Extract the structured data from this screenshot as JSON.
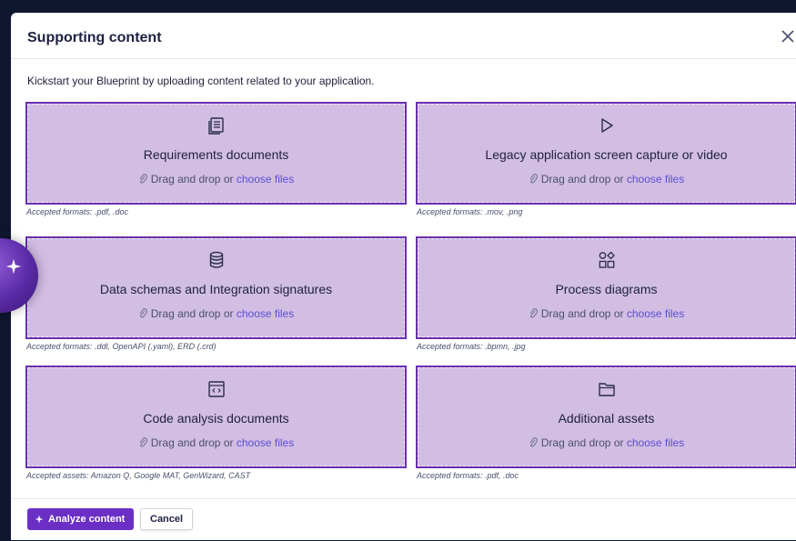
{
  "modal": {
    "title": "Supporting content",
    "intro": "Kickstart your Blueprint by uploading content related to your application."
  },
  "dropzone": {
    "drag_text": "Drag and drop or",
    "choose_text": "choose files"
  },
  "cards": [
    {
      "title": "Requirements documents",
      "icon": "document-list-icon",
      "formats": "Accepted formats: .pdf, .doc"
    },
    {
      "title": "Legacy application screen capture or video",
      "icon": "play-icon",
      "formats": "Accepted formats: .mov, .png"
    },
    {
      "title": "Data schemas and Integration signatures",
      "icon": "database-icon",
      "formats": "Accepted formats: .ddl, OpenAPI (.yaml), ERD (.crd)"
    },
    {
      "title": "Process diagrams",
      "icon": "shapes-icon",
      "formats": "Accepted formats: .bpmn, .jpg"
    },
    {
      "title": "Code analysis documents",
      "icon": "code-window-icon",
      "formats": "Accepted assets: Amazon Q, Google MAT, GenWizard, CAST"
    },
    {
      "title": "Additional assets",
      "icon": "folder-icon",
      "formats": "Accepted formats: .pdf, .doc"
    }
  ],
  "footer": {
    "analyze_label": "Analyze content",
    "cancel_label": "Cancel"
  },
  "colors": {
    "card_fill": "#d2bde3",
    "card_border": "#6a2fb0",
    "primary": "#6b2fc5",
    "link": "#5b4fd0"
  }
}
